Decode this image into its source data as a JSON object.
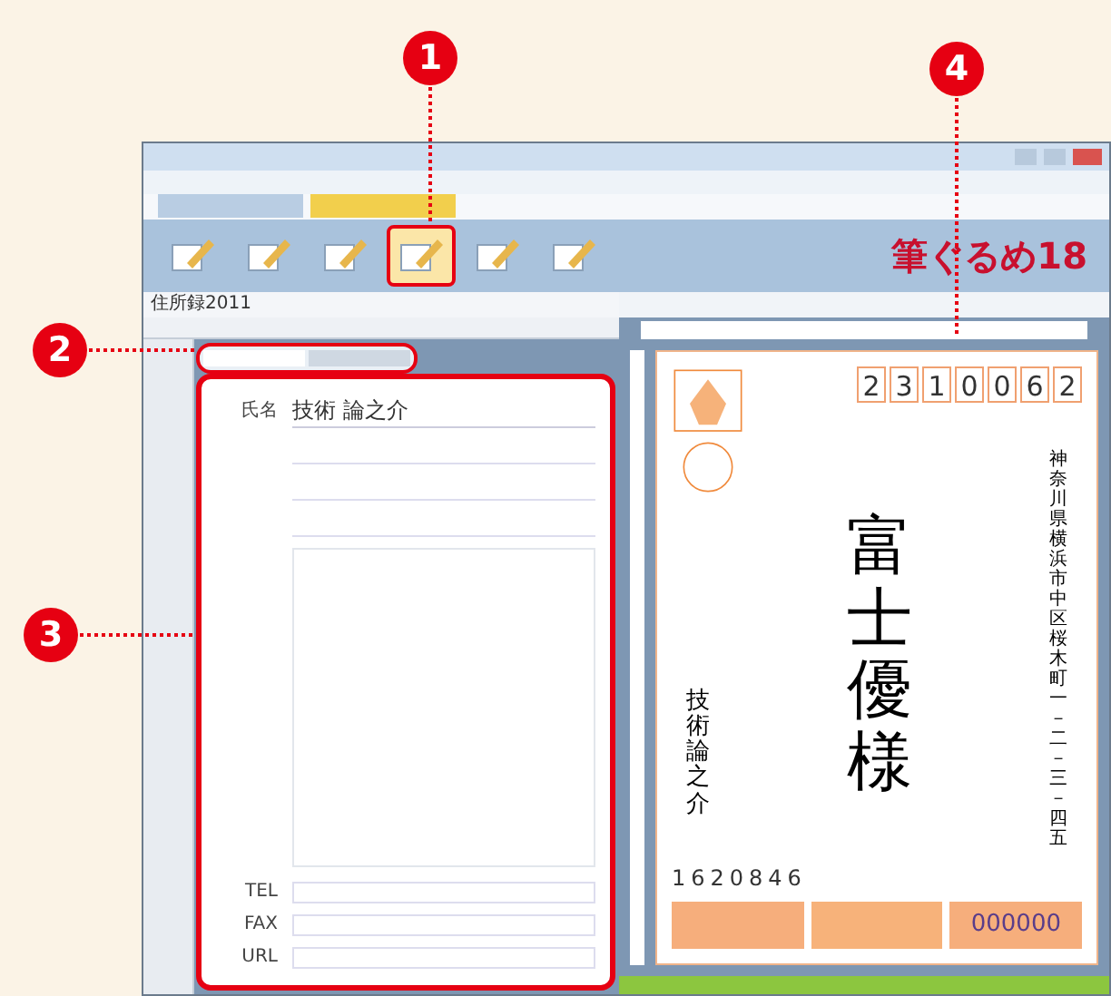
{
  "callouts": [
    {
      "number": "1"
    },
    {
      "number": "2"
    },
    {
      "number": "3"
    },
    {
      "number": "4"
    }
  ],
  "toolbar": {
    "buttons": [
      {
        "selected": false
      },
      {
        "selected": false
      },
      {
        "selected": false
      },
      {
        "selected": true
      },
      {
        "selected": false
      },
      {
        "selected": false
      }
    ],
    "brand": "筆ぐるめ18"
  },
  "address_book": {
    "title": "住所録2011",
    "tabs": [
      {
        "selected": true
      },
      {
        "selected": false
      }
    ],
    "name_field": {
      "label": "氏名",
      "value": "技術 論之介"
    },
    "contact_rows": [
      {
        "label": "TEL"
      },
      {
        "label": "FAX"
      },
      {
        "label": "URL"
      }
    ]
  },
  "postcard": {
    "postal_code_digits": [
      "2",
      "3",
      "1",
      "0",
      "0",
      "6",
      "2"
    ],
    "address": "神奈川県横浜市中区桜木町一－二－三－四五",
    "recipient": "富士優様",
    "sender_name": "技術論之介",
    "sender_postal_code": "1620846",
    "lottery_number": "000000"
  }
}
